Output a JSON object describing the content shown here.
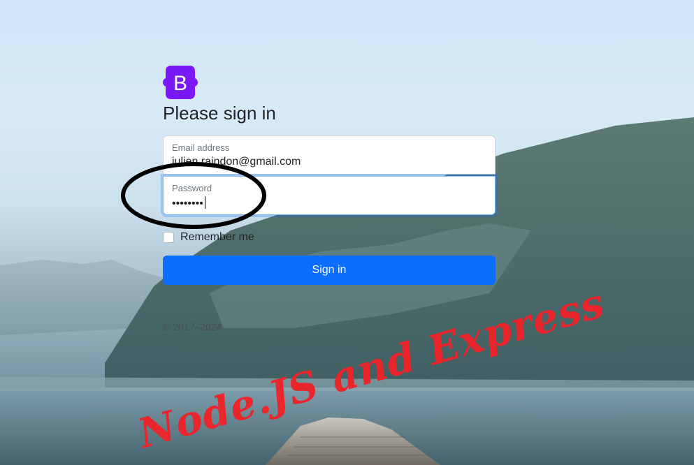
{
  "logo": {
    "letter": "B",
    "icon": "bootstrap-logo-icon",
    "color": "#7a19f5"
  },
  "form": {
    "heading": "Please sign in",
    "email": {
      "label": "Email address",
      "value": "julien.raindon@gmail.com"
    },
    "password": {
      "label": "Password",
      "value": "••••••••"
    },
    "remember_label": "Remember me",
    "remember_checked": false,
    "submit_label": "Sign in"
  },
  "footer": {
    "copyright": "© 2017–2024"
  },
  "overlay": {
    "caption": "Node.JS and Express",
    "caption_color": "#e8262c",
    "circle_color": "#000000"
  },
  "colors": {
    "primary": "#0d6efd"
  }
}
